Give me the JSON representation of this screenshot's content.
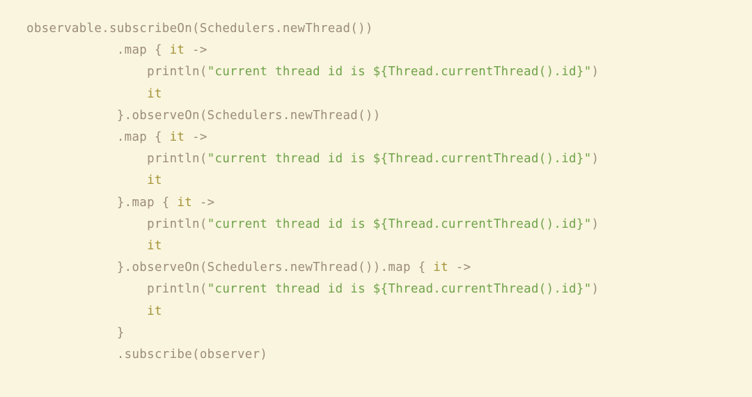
{
  "colors": {
    "background": "#faf5de",
    "default": "#9b8c7a",
    "keyword": "#a4943a",
    "string": "#6fa24a"
  },
  "code": {
    "tokens": [
      [
        [
          "d",
          "observable.subscribeOn(Schedulers.newThread())"
        ]
      ],
      [
        [
          "d",
          "            .map { "
        ],
        [
          "k",
          "it"
        ],
        [
          "d",
          " ->"
        ]
      ],
      [
        [
          "d",
          "                println("
        ],
        [
          "s",
          "\"current thread id is ${Thread.currentThread().id}\""
        ],
        [
          "d",
          ")"
        ]
      ],
      [
        [
          "d",
          "                "
        ],
        [
          "k",
          "it"
        ]
      ],
      [
        [
          "d",
          "            }.observeOn(Schedulers.newThread())"
        ]
      ],
      [
        [
          "d",
          "            .map { "
        ],
        [
          "k",
          "it"
        ],
        [
          "d",
          " ->"
        ]
      ],
      [
        [
          "d",
          "                println("
        ],
        [
          "s",
          "\"current thread id is ${Thread.currentThread().id}\""
        ],
        [
          "d",
          ")"
        ]
      ],
      [
        [
          "d",
          "                "
        ],
        [
          "k",
          "it"
        ]
      ],
      [
        [
          "d",
          "            }.map { "
        ],
        [
          "k",
          "it"
        ],
        [
          "d",
          " ->"
        ]
      ],
      [
        [
          "d",
          "                println("
        ],
        [
          "s",
          "\"current thread id is ${Thread.currentThread().id}\""
        ],
        [
          "d",
          ")"
        ]
      ],
      [
        [
          "d",
          "                "
        ],
        [
          "k",
          "it"
        ]
      ],
      [
        [
          "d",
          "            }.observeOn(Schedulers.newThread()).map { "
        ],
        [
          "k",
          "it"
        ],
        [
          "d",
          " ->"
        ]
      ],
      [
        [
          "d",
          "                println("
        ],
        [
          "s",
          "\"current thread id is ${Thread.currentThread().id}\""
        ],
        [
          "d",
          ")"
        ]
      ],
      [
        [
          "d",
          "                "
        ],
        [
          "k",
          "it"
        ]
      ],
      [
        [
          "d",
          "            }"
        ]
      ],
      [
        [
          "d",
          "            .subscribe(observer)"
        ]
      ]
    ],
    "plaintext": "observable.subscribeOn(Schedulers.newThread())\n            .map { it ->\n                println(\"current thread id is ${Thread.currentThread().id}\")\n                it\n            }.observeOn(Schedulers.newThread())\n            .map { it ->\n                println(\"current thread id is ${Thread.currentThread().id}\")\n                it\n            }.map { it ->\n                println(\"current thread id is ${Thread.currentThread().id}\")\n                it\n            }.observeOn(Schedulers.newThread()).map { it ->\n                println(\"current thread id is ${Thread.currentThread().id}\")\n                it\n            }\n            .subscribe(observer)"
  }
}
